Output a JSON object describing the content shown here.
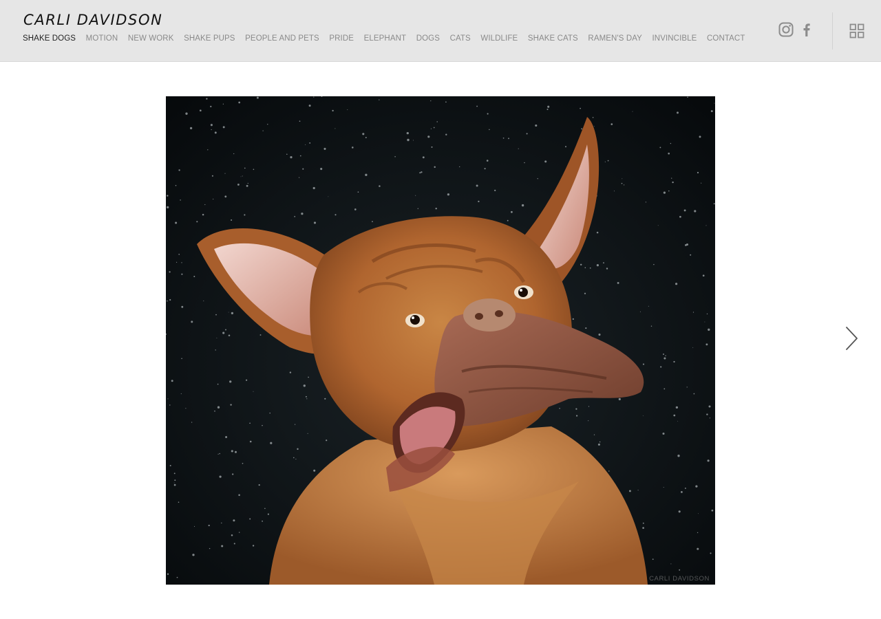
{
  "site": {
    "title": "CARLI DAVIDSON"
  },
  "nav": {
    "items": [
      {
        "label": "SHAKE DOGS",
        "active": true
      },
      {
        "label": "MOTION"
      },
      {
        "label": "NEW WORK"
      },
      {
        "label": "SHAKE PUPS"
      },
      {
        "label": "PEOPLE AND PETS"
      },
      {
        "label": "PRIDE"
      },
      {
        "label": "ELEPHANT"
      },
      {
        "label": "DOGS"
      },
      {
        "label": "CATS"
      },
      {
        "label": "WILDLIFE"
      },
      {
        "label": "SHAKE CATS"
      },
      {
        "label": "RAMEN'S DAY"
      },
      {
        "label": "INVINCIBLE"
      },
      {
        "label": "CONTACT"
      }
    ]
  },
  "social": {
    "icons": [
      "instagram-icon",
      "facebook-icon"
    ]
  },
  "toolbar": {
    "thumbnails_icon": "grid-icon"
  },
  "photo": {
    "watermark": "CARLI DAVIDSON"
  },
  "navigation": {
    "next_icon": "chevron-right-icon"
  },
  "colors": {
    "header_bg": "#e6e6e6",
    "nav_active": "#222222",
    "nav_inactive": "#8a8a8a",
    "icon_gray": "#8c8c8c",
    "photo_bg": "#0a0e10",
    "dog_fur": "#b46a35"
  }
}
